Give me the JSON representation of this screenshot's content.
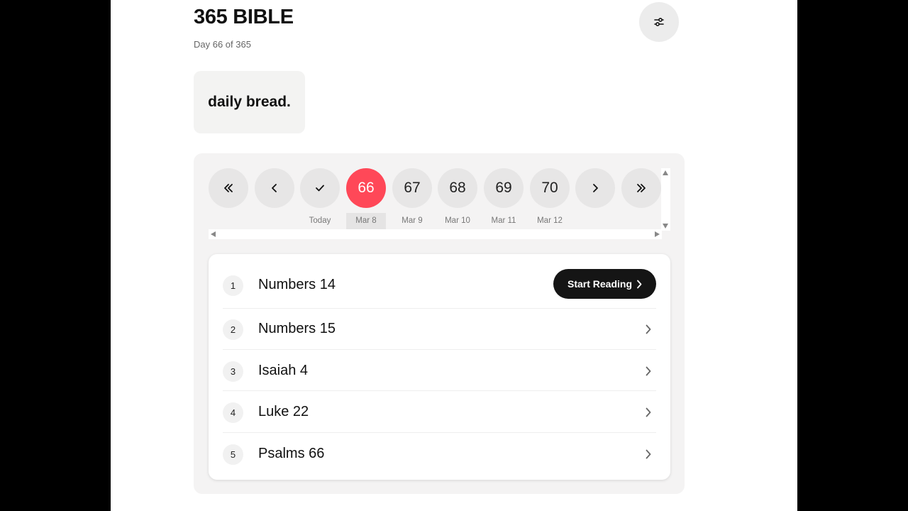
{
  "header": {
    "title": "365 BIBLE",
    "subtitle": "Day 66 of 365",
    "settings_icon": "sliders-icon"
  },
  "brand": {
    "text": "daily bread."
  },
  "day_nav": {
    "first_icon": "double-chevron-left-icon",
    "prev_icon": "chevron-left-icon",
    "today_icon": "check-icon",
    "today_label": "Today",
    "next_icon": "chevron-right-icon",
    "last_icon": "double-chevron-right-icon",
    "days": [
      {
        "num": "66",
        "date": "Mar 8",
        "active": true
      },
      {
        "num": "67",
        "date": "Mar 9"
      },
      {
        "num": "68",
        "date": "Mar 10"
      },
      {
        "num": "69",
        "date": "Mar 11"
      },
      {
        "num": "70",
        "date": "Mar 12"
      }
    ],
    "accent_color": "#ff4858"
  },
  "readings": {
    "start_label": "Start Reading",
    "items": [
      {
        "index": "1",
        "title": "Numbers 14"
      },
      {
        "index": "2",
        "title": "Numbers 15"
      },
      {
        "index": "3",
        "title": "Isaiah 4"
      },
      {
        "index": "4",
        "title": "Luke 22"
      },
      {
        "index": "5",
        "title": "Psalms 66"
      }
    ]
  }
}
